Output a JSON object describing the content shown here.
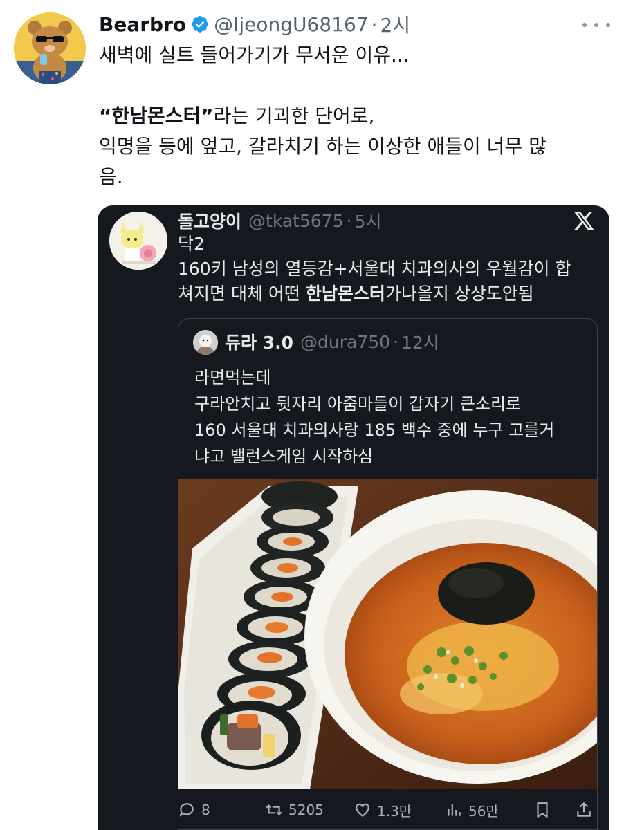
{
  "tweet": {
    "author_name": "Bearbro",
    "handle": "@IjeongU68167",
    "separator": "·",
    "time": "2시",
    "lines": {
      "l1": "새벽에 실트 들어가기가 무서운 이유...",
      "l2_bold": "“한남몬스터”",
      "l2_rest": "라는 기괴한 단어로,",
      "l3": "익명을 등에 엎고, 갈라치기 하는 이상한 애들이 너무 많",
      "l4": "음."
    }
  },
  "quoted": {
    "author_name": "돌고양이",
    "handle": "@tkat5675",
    "separator": "·",
    "time": "5시",
    "line1": "닥2",
    "line2": "160키 남성의 열등감+서울대 치과의사의 우월감이 합",
    "line3_a": "쳐지면 대체 어떤 ",
    "line3_bold": "한남몬스터",
    "line3_b": "가나올지 상상도안됨",
    "inner": {
      "author_name": "듀라 3.0",
      "handle": "@dura750",
      "separator": "·",
      "time": "12시",
      "lines": [
        "라면먹는데",
        "구라안치고 뒷자리 아줌마들이 갑자기 큰소리로",
        "160 서울대 치과의사랑 185 백수 중에 누구 고를거",
        "냐고 밸런스게임 시작하심"
      ]
    },
    "actions": {
      "replies": "8",
      "reposts": "5205",
      "likes": "1.3만",
      "views": "56만"
    }
  },
  "icons": {
    "verified": "verified-badge-icon",
    "more": "more-dots-icon",
    "x_logo": "x-logo-icon",
    "reply": "reply-icon",
    "repost": "repost-icon",
    "like": "heart-icon",
    "views": "views-chart-icon",
    "bookmark": "bookmark-icon",
    "share": "share-icon"
  },
  "colors": {
    "verified_blue": "#1d9bf0",
    "card_background": "#15191f",
    "muted_text": "#71767b"
  }
}
